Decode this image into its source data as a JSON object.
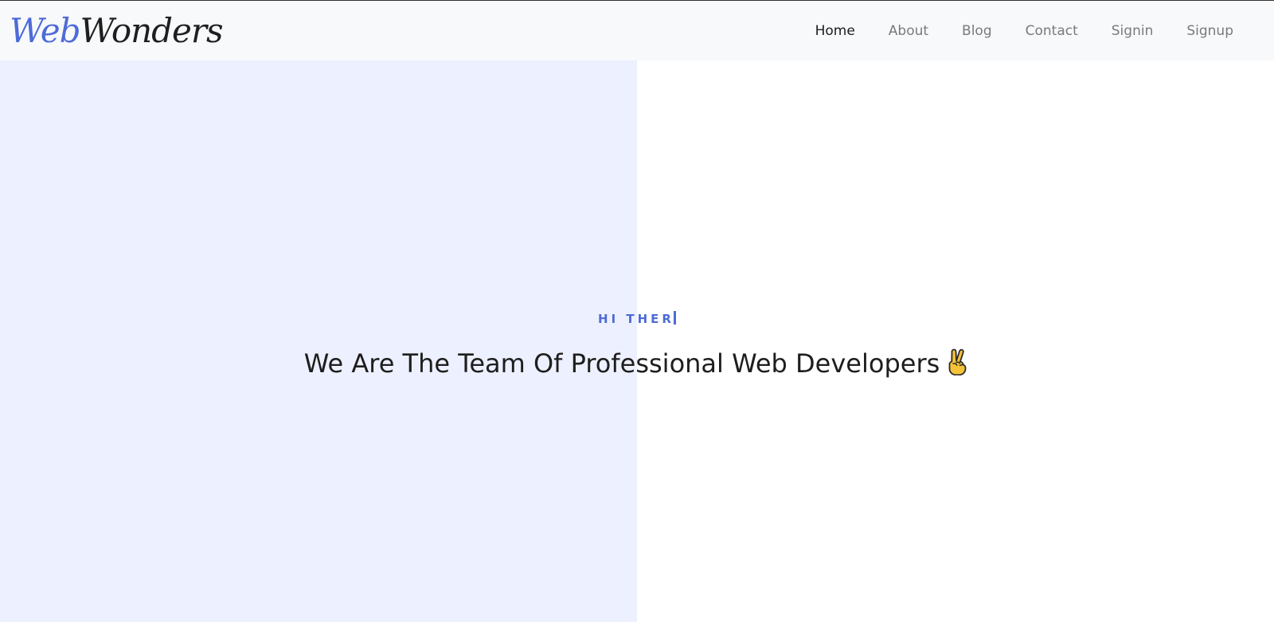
{
  "header": {
    "logo": {
      "part1": "Web",
      "part2": "Wonders"
    },
    "nav": [
      {
        "label": "Home",
        "active": true
      },
      {
        "label": "About",
        "active": false
      },
      {
        "label": "Blog",
        "active": false
      },
      {
        "label": "Contact",
        "active": false
      },
      {
        "label": "Signin",
        "active": false
      },
      {
        "label": "Signup",
        "active": false
      }
    ]
  },
  "hero": {
    "greeting": "HI THER",
    "heading": "We Are The Team Of Professional Web Developers",
    "emoji_icon": "victory-hand-icon"
  },
  "colors": {
    "accent": "#4d6bd8",
    "hero_left_bg": "#edf0fe",
    "navbar_bg": "#f8f9fb",
    "heading_text": "#1e1e1e",
    "nav_text": "#7a7a7a",
    "nav_active_text": "#1c1c1c"
  }
}
